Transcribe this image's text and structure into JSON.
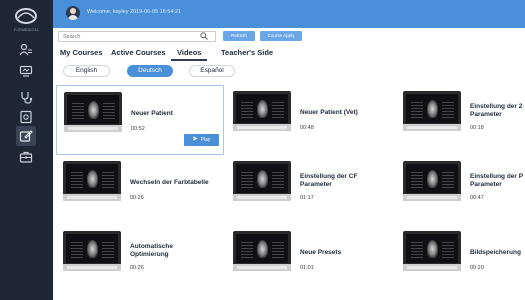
{
  "brand": {
    "name": "FORMEDICAL"
  },
  "header": {
    "welcome": "Welcome, kayley   2019-06-05 16:54:21"
  },
  "toolbar": {
    "search_placeholder": "Search",
    "refresh_label": "Refresh",
    "course_apply_label": "Course Apply"
  },
  "tabs": [
    {
      "label": "My Courses"
    },
    {
      "label": "Active Courses"
    },
    {
      "label": "Videos",
      "active": true
    },
    {
      "label": "Teacher's Side"
    }
  ],
  "languages": [
    {
      "label": "English"
    },
    {
      "label": "Deutsch",
      "active": true
    },
    {
      "label": "Español"
    }
  ],
  "sidebar": {
    "icons": [
      "students-icon",
      "monitor-icon",
      "stethoscope-icon",
      "exam-icon",
      "edit-icon",
      "briefcase-icon"
    ]
  },
  "videos": [
    {
      "title": "Neuer Patient",
      "duration": "00:52",
      "selected": true,
      "play_label": "Play"
    },
    {
      "title": "Neuer Patient (Vet)",
      "duration": "00:48"
    },
    {
      "title": "Einstellung der 2",
      "title2": "Parameter",
      "duration": "00:18"
    },
    {
      "title": "Wechseln der Farbtabelle",
      "duration": "00:26"
    },
    {
      "title": "Einstellung der CF",
      "title2": "Parameter",
      "duration": "01:17"
    },
    {
      "title": "Einstellung der P",
      "title2": "Parameter",
      "duration": "00:47"
    },
    {
      "title": "Automatische",
      "title2": "Optimierung",
      "duration": "00:26"
    },
    {
      "title": "Neue Presets",
      "duration": "01:01"
    },
    {
      "title": "Bildspeicherung",
      "duration": "00:20"
    }
  ],
  "colors": {
    "accent": "#4a90d9",
    "sidebar": "#1f2736",
    "topbar": "#4a90d9"
  }
}
